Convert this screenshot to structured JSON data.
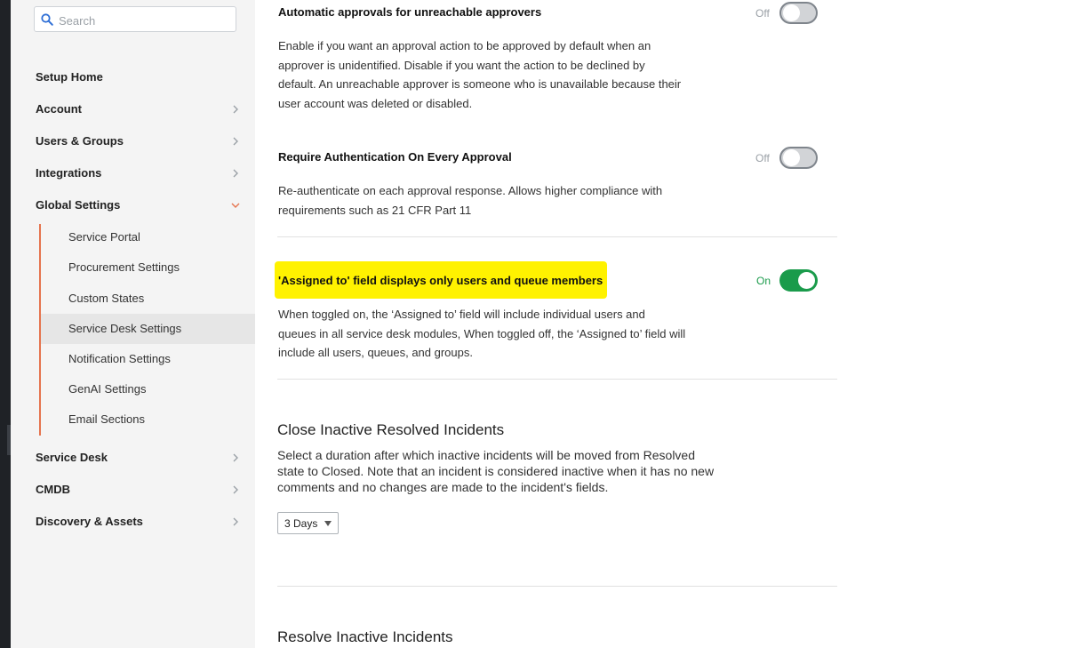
{
  "search": {
    "placeholder": "Search"
  },
  "sidebar": {
    "items": [
      {
        "label": "Setup Home"
      },
      {
        "label": "Account"
      },
      {
        "label": "Users & Groups"
      },
      {
        "label": "Integrations"
      },
      {
        "label": "Global Settings"
      },
      {
        "label": "Service Desk"
      },
      {
        "label": "CMDB"
      },
      {
        "label": "Discovery & Assets"
      }
    ],
    "global_settings_children": [
      {
        "label": "Service Portal"
      },
      {
        "label": "Procurement Settings"
      },
      {
        "label": "Custom States"
      },
      {
        "label": "Service Desk Settings",
        "active": true
      },
      {
        "label": "Notification Settings"
      },
      {
        "label": "GenAI Settings"
      },
      {
        "label": "Email Sections"
      }
    ]
  },
  "settings": [
    {
      "title": "Automatic approvals for unreachable approvers",
      "state": "Off",
      "desc_lines": [
        "Enable if you want an approval action to be approved by default when an",
        "approver is unidentified. Disable if you want the action to be declined by",
        "default. An unreachable approver is someone who is unavailable because their",
        "user account was deleted or disabled."
      ]
    },
    {
      "title": "Require Authentication On Every Approval",
      "state": "Off",
      "desc_lines": [
        "Re-authenticate on each approval response. Allows higher compliance with",
        "requirements such as 21 CFR Part 11"
      ]
    },
    {
      "title": "'Assigned to' field displays only users and queue members",
      "state": "On",
      "desc_lines": [
        "When toggled on, the ‘Assigned to’ field will include individual users and",
        "queues in all service desk modules, When toggled off, the ‘Assigned to’ field will",
        "include all users, queues, and groups."
      ]
    }
  ],
  "close_inactive": {
    "title": "Close Inactive Resolved Incidents",
    "desc_lines": [
      "Select a duration after which inactive incidents will be moved from Resolved",
      "state to Closed. Note that an incident is considered inactive when it has no new",
      "comments and no changes are made to the incident's fields."
    ],
    "selected": "3 Days"
  },
  "resolve_inactive": {
    "title": "Resolve Inactive Incidents"
  },
  "colors": {
    "accent": "#e5744e",
    "toggle_on": "#1a9b4b",
    "highlight": "#fff200"
  }
}
